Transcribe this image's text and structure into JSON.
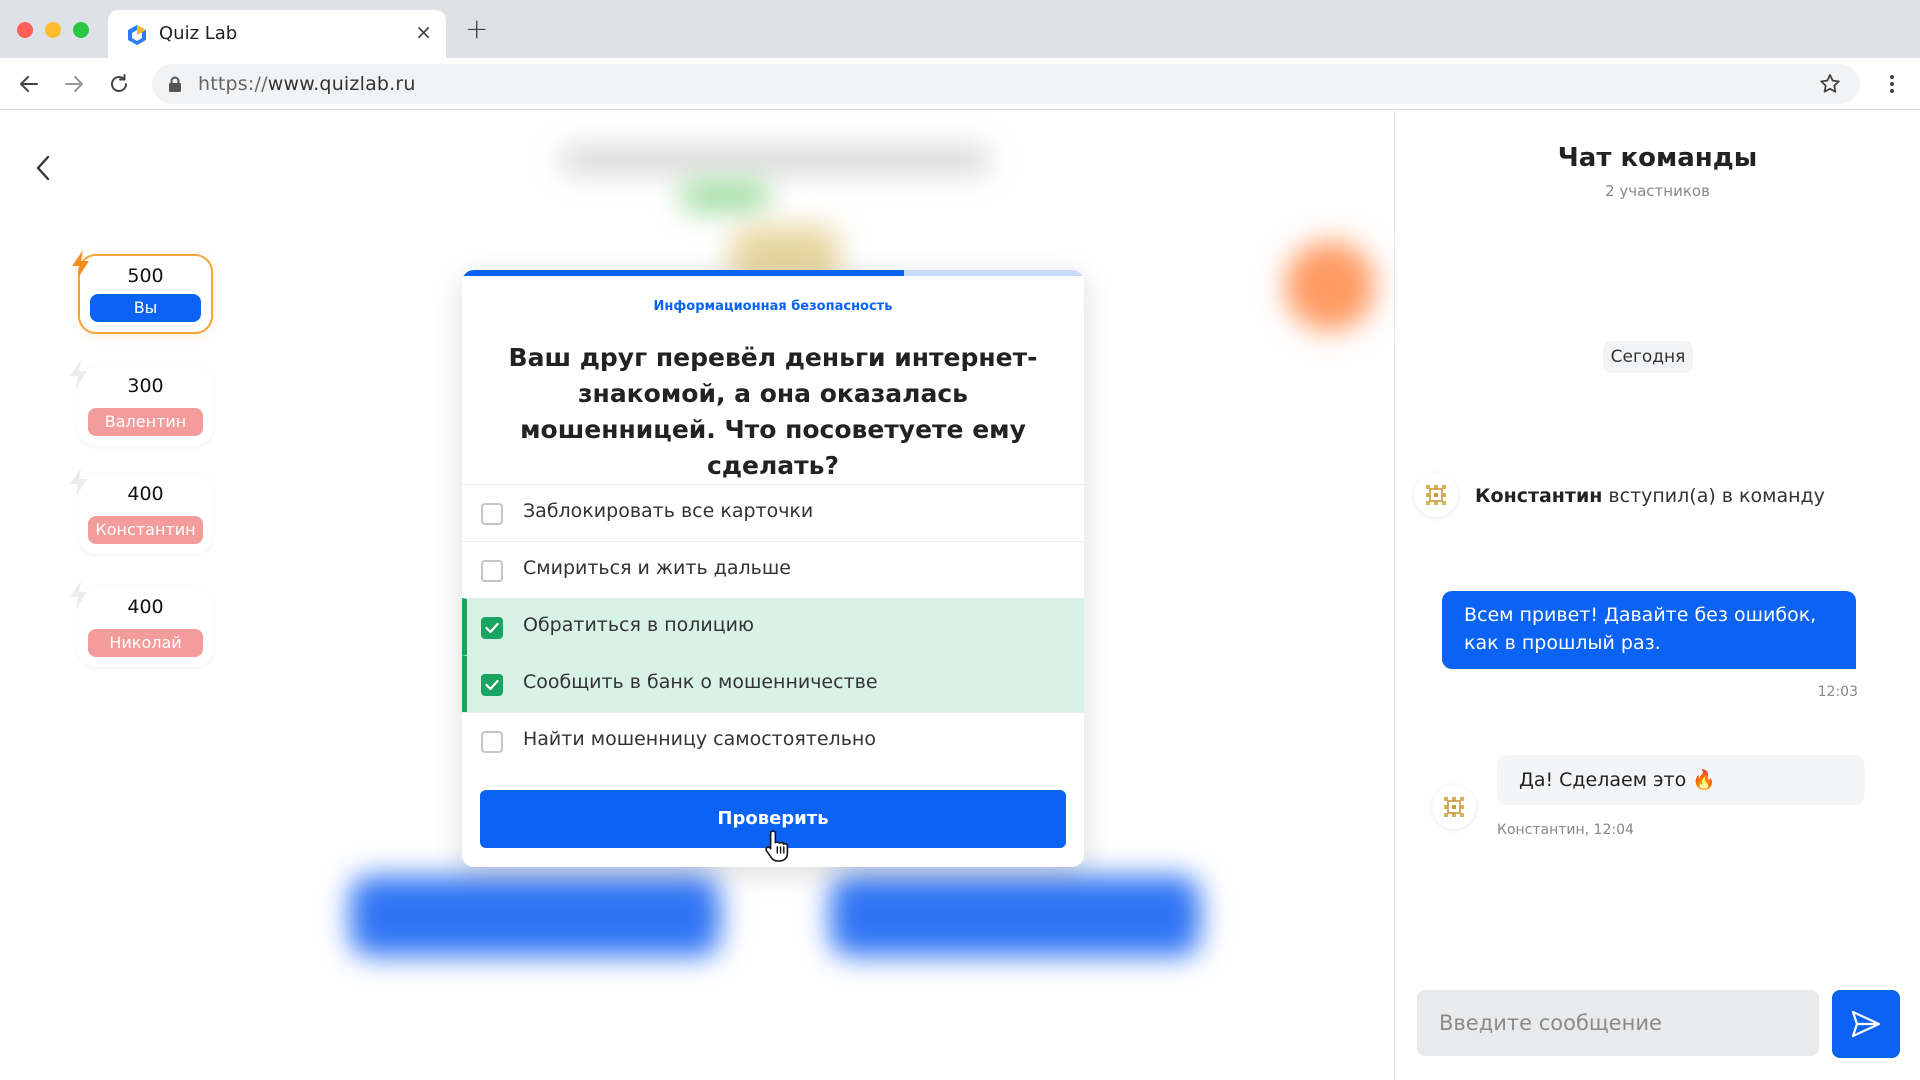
{
  "browser": {
    "tab_title": "Quiz Lab",
    "new_tab_symbol": "+",
    "close_symbol": "×",
    "url_protocol": "https://",
    "url_host": "www.quizlab.ru"
  },
  "players": [
    {
      "score": "500",
      "name": "Вы",
      "is_you": true
    },
    {
      "score": "300",
      "name": "Валентин",
      "is_you": false
    },
    {
      "score": "400",
      "name": "Константин",
      "is_you": false
    },
    {
      "score": "400",
      "name": "Николай",
      "is_you": false
    }
  ],
  "quiz": {
    "progress": 0.71,
    "category": "Информационная безопасность",
    "question": "Ваш друг перевёл деньги интернет-знакомой, а она оказалась мошенницей. Что посоветуете ему сделать?",
    "options": [
      {
        "label": "Заблокировать все карточки",
        "checked": false
      },
      {
        "label": "Смириться и жить дальше",
        "checked": false
      },
      {
        "label": "Обратиться в полицию",
        "checked": true
      },
      {
        "label": "Сообщить в банк о мошенничестве",
        "checked": true
      },
      {
        "label": "Найти мошенницу самостоятельно",
        "checked": false
      }
    ],
    "submit_label": "Проверить"
  },
  "chat": {
    "title": "Чат команды",
    "subtitle": "2 участников",
    "date_label": "Сегодня",
    "join_event": {
      "name": "Константин",
      "text": " вступил(а) в команду"
    },
    "outgoing": {
      "text": "Всем привет! Давайте без ошибок, как в прошлый раз.",
      "time": "12:03"
    },
    "incoming": {
      "text": "Да! Сделаем это 🔥",
      "meta": "Константин, 12:04"
    },
    "input_placeholder": "Введите сообщение"
  },
  "colors": {
    "accent": "#0a63f2",
    "correct": "#19a462",
    "correct_bg": "#d9f2e7",
    "you_border": "#f5a43a",
    "other_player": "#f49b9b"
  },
  "icons": [
    "quizlab-favicon",
    "back-icon",
    "forward-icon",
    "reload-icon",
    "lock-icon",
    "star-icon",
    "menu-icon",
    "bolt-icon",
    "checkmark-icon",
    "cursor-icon",
    "avatar-pattern-icon",
    "send-icon"
  ]
}
